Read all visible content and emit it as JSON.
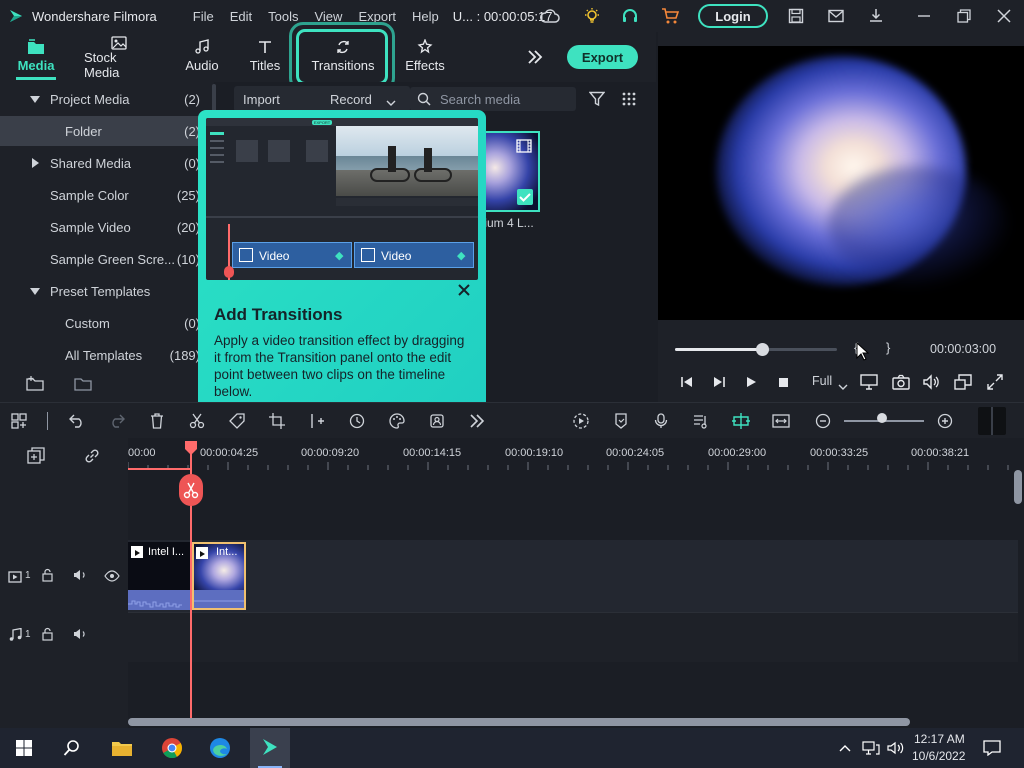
{
  "window": {
    "app_title": "Wondershare Filmora",
    "menu": [
      "File",
      "Edit",
      "Tools",
      "View",
      "Export",
      "Help"
    ],
    "project": "U... : 00:00:05:17",
    "login_label": "Login"
  },
  "modules": {
    "tabs": [
      {
        "label": "Media",
        "icon": "media-folder-icon"
      },
      {
        "label": "Stock Media",
        "icon": "stock-media-icon"
      },
      {
        "label": "Audio",
        "icon": "music-note-icon"
      },
      {
        "label": "Titles",
        "icon": "text-t-icon"
      },
      {
        "label": "Transitions",
        "icon": "transitions-icon"
      },
      {
        "label": "Effects",
        "icon": "effects-icon"
      }
    ],
    "export_label": "Export"
  },
  "library": {
    "items": [
      {
        "label": "Project Media",
        "count": "(2)"
      },
      {
        "label": "Folder",
        "count": "(2)"
      },
      {
        "label": "Shared Media",
        "count": "(0)"
      },
      {
        "label": "Sample Color",
        "count": "(25)"
      },
      {
        "label": "Sample Video",
        "count": "(20)"
      },
      {
        "label": "Sample Green Scre...",
        "count": "(10)"
      },
      {
        "label": "Preset Templates",
        "count": ""
      },
      {
        "label": "Custom",
        "count": "(0)"
      },
      {
        "label": "All Templates",
        "count": "(189)"
      }
    ]
  },
  "media_toolbar": {
    "import_label": "Import",
    "record_label": "Record",
    "search_placeholder": "Search media",
    "thumb_caption": "tium 4 L..."
  },
  "tooltip": {
    "title": "Add Transitions",
    "description": "Apply a video transition effect by dragging it from the Transition panel onto the edit point between two clips on the timeline below.",
    "clip_label_1": "Video",
    "clip_label_2": "Video",
    "export_badge": "EXPORT"
  },
  "preview": {
    "timecode": "00:00:03:00",
    "quality": "Full",
    "progress": 0.54
  },
  "timeline": {
    "ruler": [
      "00:00",
      "00:00:04:25",
      "00:00:09:20",
      "00:00:14:15",
      "00:00:19:10",
      "00:00:24:05",
      "00:00:29:00",
      "00:00:33:25",
      "00:00:38:21"
    ],
    "video_track_label": "1",
    "audio_track_label": "1",
    "clip1_label": "Intel I...",
    "clip2_label": "Int..."
  },
  "taskbar": {
    "time": "12:17 AM",
    "date": "10/6/2022"
  },
  "colors": {
    "accent": "#3ee2c0",
    "playhead": "#ff6b6b",
    "background": "#1b1e25"
  }
}
